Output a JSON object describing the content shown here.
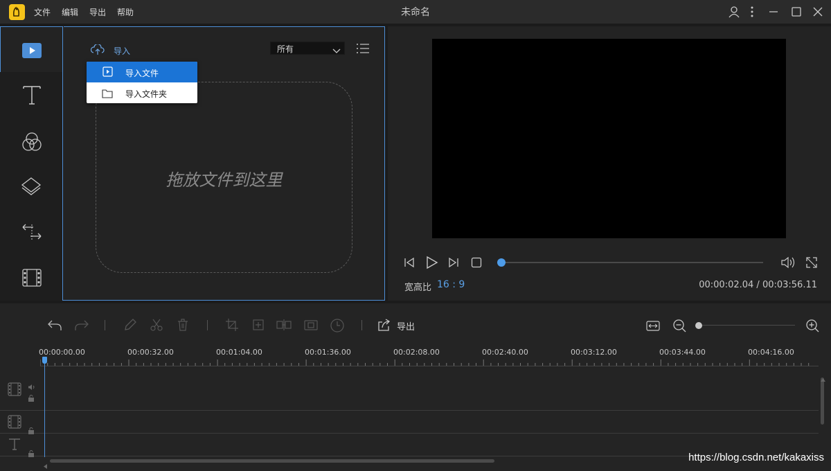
{
  "app": {
    "title": "未命名",
    "menu": [
      "文件",
      "编辑",
      "导出",
      "帮助"
    ]
  },
  "media": {
    "import_label": "导入",
    "filter_value": "所有",
    "drop_hint": "拖放文件到这里",
    "import_menu": {
      "import_file": "导入文件",
      "import_folder": "导入文件夹"
    }
  },
  "preview": {
    "aspect_label": "宽高比",
    "aspect_value": "16 : 9",
    "time_readout": "00:00:02.04 / 00:03:56.11",
    "seek_progress": 0.0
  },
  "timeline": {
    "export_label": "导出",
    "ticks": [
      "00:00:00.00",
      "00:00:32.00",
      "00:01:04.00",
      "00:01:36.00",
      "00:02:08.00",
      "00:02:40.00",
      "00:03:12.00",
      "00:03:44.00",
      "00:04:16.00"
    ],
    "zoom_level": 0.0
  },
  "watermark": "https://blog.csdn.net/kakaxiss",
  "colors": {
    "accent": "#4d8fd8",
    "menu_highlight": "#1b74d6",
    "logo": "#f5c31a",
    "aspect_value": "#5aa0e6"
  }
}
